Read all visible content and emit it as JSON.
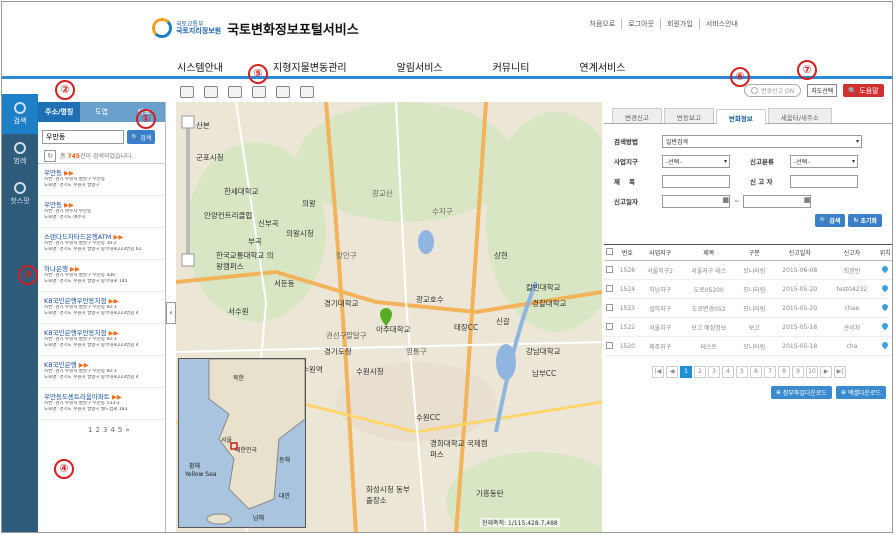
{
  "header": {
    "org_line1": "국토교통부",
    "org_line2": "국토지리정보원",
    "title": "국토변화정보포털서비스",
    "util_links": [
      "처음으로",
      "로그아웃",
      "회원가입",
      "서비스안내"
    ]
  },
  "gnb": [
    "시스템안내",
    "지형지물변동관리",
    "알림서비스",
    "커뮤니티",
    "연계서비스"
  ],
  "rail": [
    {
      "label": "검색",
      "icon": "search-icon"
    },
    {
      "label": "범례",
      "icon": "legend-icon"
    },
    {
      "label": "핫스팟",
      "icon": "hotspot-icon"
    }
  ],
  "search_panel": {
    "tabs": [
      "주소/명칭",
      "도엽",
      "좌표"
    ],
    "query": "우만동",
    "search_label": "검색",
    "count_prefix": "총 ",
    "count": "745",
    "count_suffix": "건이 검색되었습니다.",
    "results": [
      {
        "name": "우만동",
        "addr1": "지번: 경기 수원시 팔달구 우만동",
        "addr2": "도로명: 경기도 수원시 팔달구"
      },
      {
        "name": "우만동",
        "addr1": "지번: 경기 여주시 우만동",
        "addr2": "도로명: 경기도 여주시"
      },
      {
        "name": "스탠다드차타드은행ATM",
        "addr1": "지번: 경기 수원시 팔달구 우만동 30-2",
        "addr2": "도로명: 경기도 수원시 팔달구 중부대로223번길 61"
      },
      {
        "name": "하나은행",
        "addr1": "지번: 경기 수원시 팔달구 우만동 436",
        "addr2": "도로명: 경기도 수원시 팔달구 중부대로 145"
      },
      {
        "name": "KB국민은행우만동지점",
        "addr1": "지번: 경기 수원시 팔달구 우만동 92-1",
        "addr2": "도로명: 경기도 수원시 팔달구 중부대로223번길 4"
      },
      {
        "name": "KB국민은행우만동지점",
        "addr1": "지번: 경기 수원시 팔달구 우만동 92-1",
        "addr2": "도로명: 경기도 수원시 팔달구 중부대로223번길 4"
      },
      {
        "name": "KB국민은행",
        "addr1": "지번: 경기 수원시 팔달구 우만동 92-1",
        "addr2": "도로명: 경기도 수원시 팔달구 중부대로223번길 4"
      },
      {
        "name": "우만동도센트리움아파트",
        "addr1": "지번: 경기 수원시 팔달구 우만동 533-1",
        "addr2": "도로명: 경기도 수원시 팔달구 월드컵로 183"
      }
    ],
    "pages": [
      "1",
      "2",
      "3",
      "4",
      "5",
      "»"
    ]
  },
  "map": {
    "labels": [
      "산본",
      "군포시청",
      "한세대학교",
      "의왕",
      "안양컨트리클럽",
      "신부곡",
      "의왕시청",
      "부곡",
      "한국교통대학교 의왕캠퍼스",
      "광교산",
      "서둔동",
      "경기대학교",
      "수원역",
      "수원시청",
      "아주대학교",
      "서수원",
      "권선구",
      "광교호수",
      "경기도청",
      "태장CC",
      "신갈",
      "영통구",
      "경희대학교 국제캠퍼스",
      "기흥동탄",
      "수원CC",
      "수지구",
      "상현",
      "칼빈대학교",
      "경찰대학교",
      "강남대학교",
      "남부CC",
      "화성시청 동부출장소",
      "장안구",
      "팔달구"
    ],
    "scale": "현재축척: 1/115,428.7,488",
    "inset": [
      "북한",
      "황해",
      "대한민국",
      "동해",
      "남해",
      "Yellow Sea",
      "대한",
      "서울"
    ]
  },
  "toolbar": {
    "toggle_label": "변경신고 ON",
    "maptype_label": "지도선택",
    "help_label": "도움말"
  },
  "right_panel": {
    "tabs": [
      "변경신고",
      "변동보고",
      "변화정보",
      "세움터/새주소"
    ],
    "active_tab": 2,
    "method_label": "검색방법",
    "method_value": "일반검색",
    "district_label": "사업지구",
    "district_value": "-선택-",
    "category_label": "신고분류",
    "category_value": "-선택-",
    "title_label": "제    목",
    "reporter_label": "신 고 자",
    "date_label": "신고일자",
    "date_sep": "~",
    "search_btn": "검색",
    "reset_btn": "초기화",
    "columns": [
      "번호",
      "사업지구",
      "제목",
      "구분",
      "신고일자",
      "신고자",
      "위치"
    ],
    "rows": [
      [
        "1528",
        "서울지구2",
        "서울지구 테스",
        "모니터링",
        "2015-06-08",
        "최정빈"
      ],
      [
        "1524",
        "하남지구",
        "도로05200",
        "모니터링",
        "2015-05-20",
        "test04232"
      ],
      [
        "1523",
        "설악지구",
        "도로변경052",
        "모니터링",
        "2015-05-20",
        "chae"
      ],
      [
        "1522",
        "서울지구",
        "보고 예정정보",
        "보고",
        "2015-05-18",
        "관리자"
      ],
      [
        "1520",
        "제주지구",
        "테스트",
        "모니터링",
        "2015-05-18",
        "cha"
      ]
    ],
    "pages": [
      "|◀",
      "◀",
      "1",
      "2",
      "3",
      "4",
      "5",
      "6",
      "7",
      "8",
      "9",
      "10",
      "▶",
      "▶|"
    ],
    "download_shp": "첨부파일다운로드",
    "download_xls": "엑셀다운로드"
  },
  "markers": [
    "①",
    "②",
    "③",
    "④",
    "⑤",
    "⑥",
    "⑦"
  ]
}
